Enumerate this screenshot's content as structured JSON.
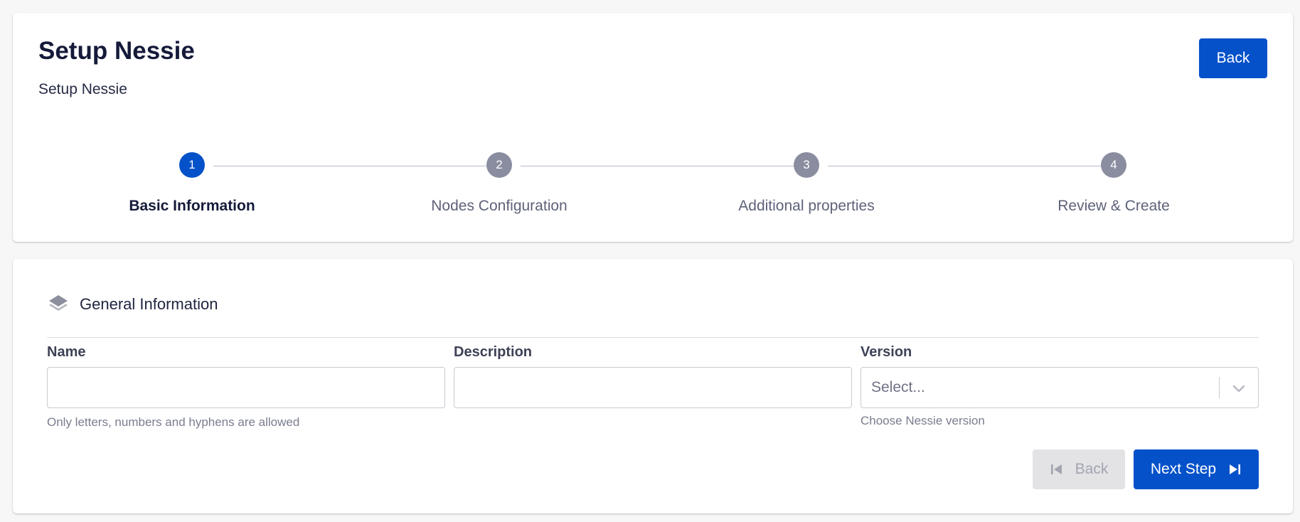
{
  "header": {
    "title": "Setup Nessie",
    "subtitle": "Setup Nessie",
    "back_label": "Back"
  },
  "stepper": {
    "steps": [
      {
        "number": "1",
        "label": "Basic Information",
        "active": true
      },
      {
        "number": "2",
        "label": "Nodes Configuration",
        "active": false
      },
      {
        "number": "3",
        "label": "Additional properties",
        "active": false
      },
      {
        "number": "4",
        "label": "Review & Create",
        "active": false
      }
    ]
  },
  "form": {
    "section_title": "General Information",
    "section_icon": "layers-icon",
    "fields": {
      "name": {
        "label": "Name",
        "value": "",
        "placeholder": "",
        "helper": "Only letters, numbers and hyphens are allowed"
      },
      "description": {
        "label": "Description",
        "value": "",
        "placeholder": ""
      },
      "version": {
        "label": "Version",
        "placeholder": "Select...",
        "helper": "Choose Nessie version"
      }
    },
    "actions": {
      "back_label": "Back",
      "next_label": "Next Step"
    }
  },
  "colors": {
    "primary": "#0451c9",
    "step_inactive": "#8a8da0",
    "disabled_bg": "#e3e3e6",
    "disabled_text": "#a2a4b0"
  }
}
